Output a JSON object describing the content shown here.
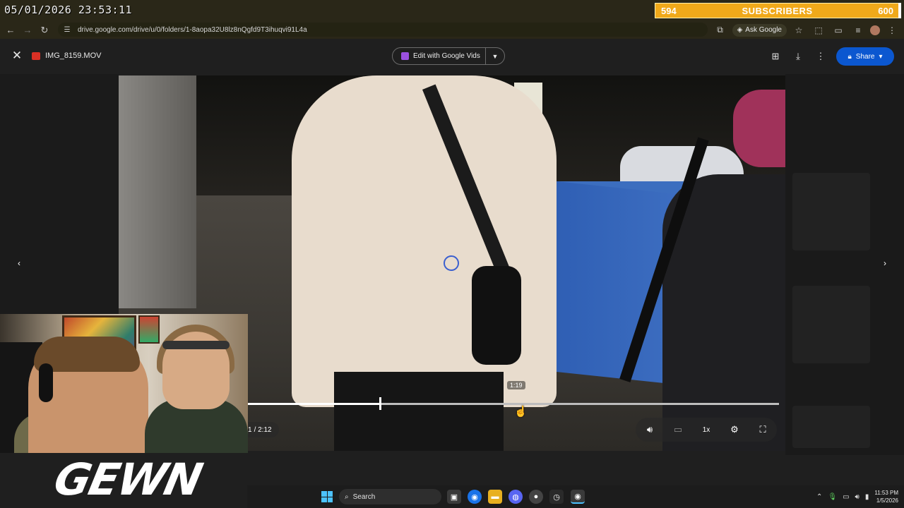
{
  "overlay": {
    "datetime": "05/01/2026 23:53:11",
    "subscriber_bar": {
      "current": "594",
      "label": "SUBSCRIBERS",
      "goal": "600",
      "progress_fraction": 0.99
    }
  },
  "browser": {
    "url": "drive.google.com/drive/u/0/folders/1-8aopa32U8lz8nQgfd9T3ihuqvi91L4a",
    "ask_google_label": "Ask Google"
  },
  "viewer": {
    "file_name": "IMG_8159.MOV",
    "edit_vids_label": "Edit with Google Vids",
    "share_label": "Share"
  },
  "player": {
    "current_time_fragment": "1",
    "duration": "/ 2:12",
    "hover_time": "1:19",
    "speed": "1x",
    "played_fraction": 0.25
  },
  "logo_text": "GEWN",
  "taskbar": {
    "search_label": "Search",
    "time": "11:53 PM",
    "date": "1/5/2026"
  },
  "colors": {
    "share_blue": "#0b57d0",
    "subscriber_orange": "#f0a91a",
    "chrome_bg": "#2a2718"
  },
  "icons": [
    "back-arrow-icon",
    "forward-arrow-icon",
    "reload-icon",
    "site-info-icon",
    "bookmark-star-icon",
    "extensions-icon",
    "close-icon",
    "add-to-drive-icon",
    "download-icon",
    "more-icon",
    "lock-icon",
    "volume-icon",
    "captions-icon",
    "settings-gear-icon",
    "fullscreen-icon",
    "prev-arrow-icon",
    "next-arrow-icon",
    "windows-start-icon",
    "search-icon"
  ]
}
